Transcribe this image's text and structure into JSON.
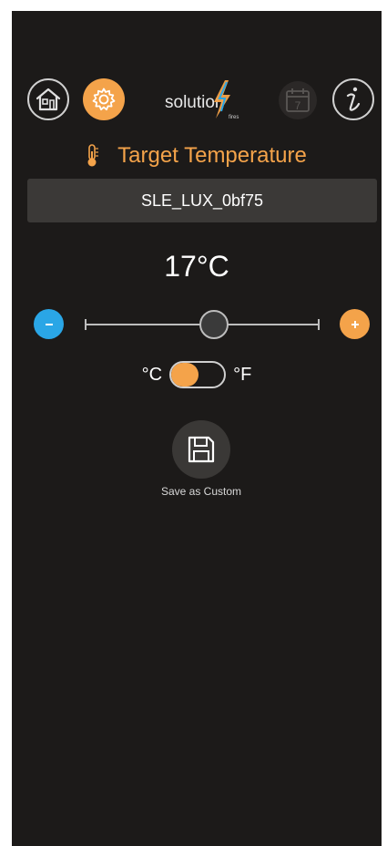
{
  "header": {
    "logo_text": "solution",
    "logo_subtext": "fires",
    "calendar_day": "7"
  },
  "icons": {
    "home": "home-icon",
    "settings": "gear-icon",
    "calendar": "calendar-icon",
    "info": "info-icon",
    "thermometer": "thermometer-icon",
    "save": "floppy-disk-icon"
  },
  "title": "Target Temperature",
  "device_name": "SLE_LUX_0bf75",
  "temperature": {
    "display": "17°C",
    "value": 17,
    "unit": "°C",
    "slider_fraction": 0.55
  },
  "unit_toggle": {
    "left_label": "°C",
    "right_label": "°F",
    "selected": "°C"
  },
  "controls": {
    "decrease_symbol": "−",
    "increase_symbol": "+"
  },
  "save": {
    "label": "Save as Custom"
  },
  "colors": {
    "accent": "#f4a34a",
    "decrease": "#2aa6e6",
    "background": "#1c1a19",
    "panel": "#3b3937"
  }
}
